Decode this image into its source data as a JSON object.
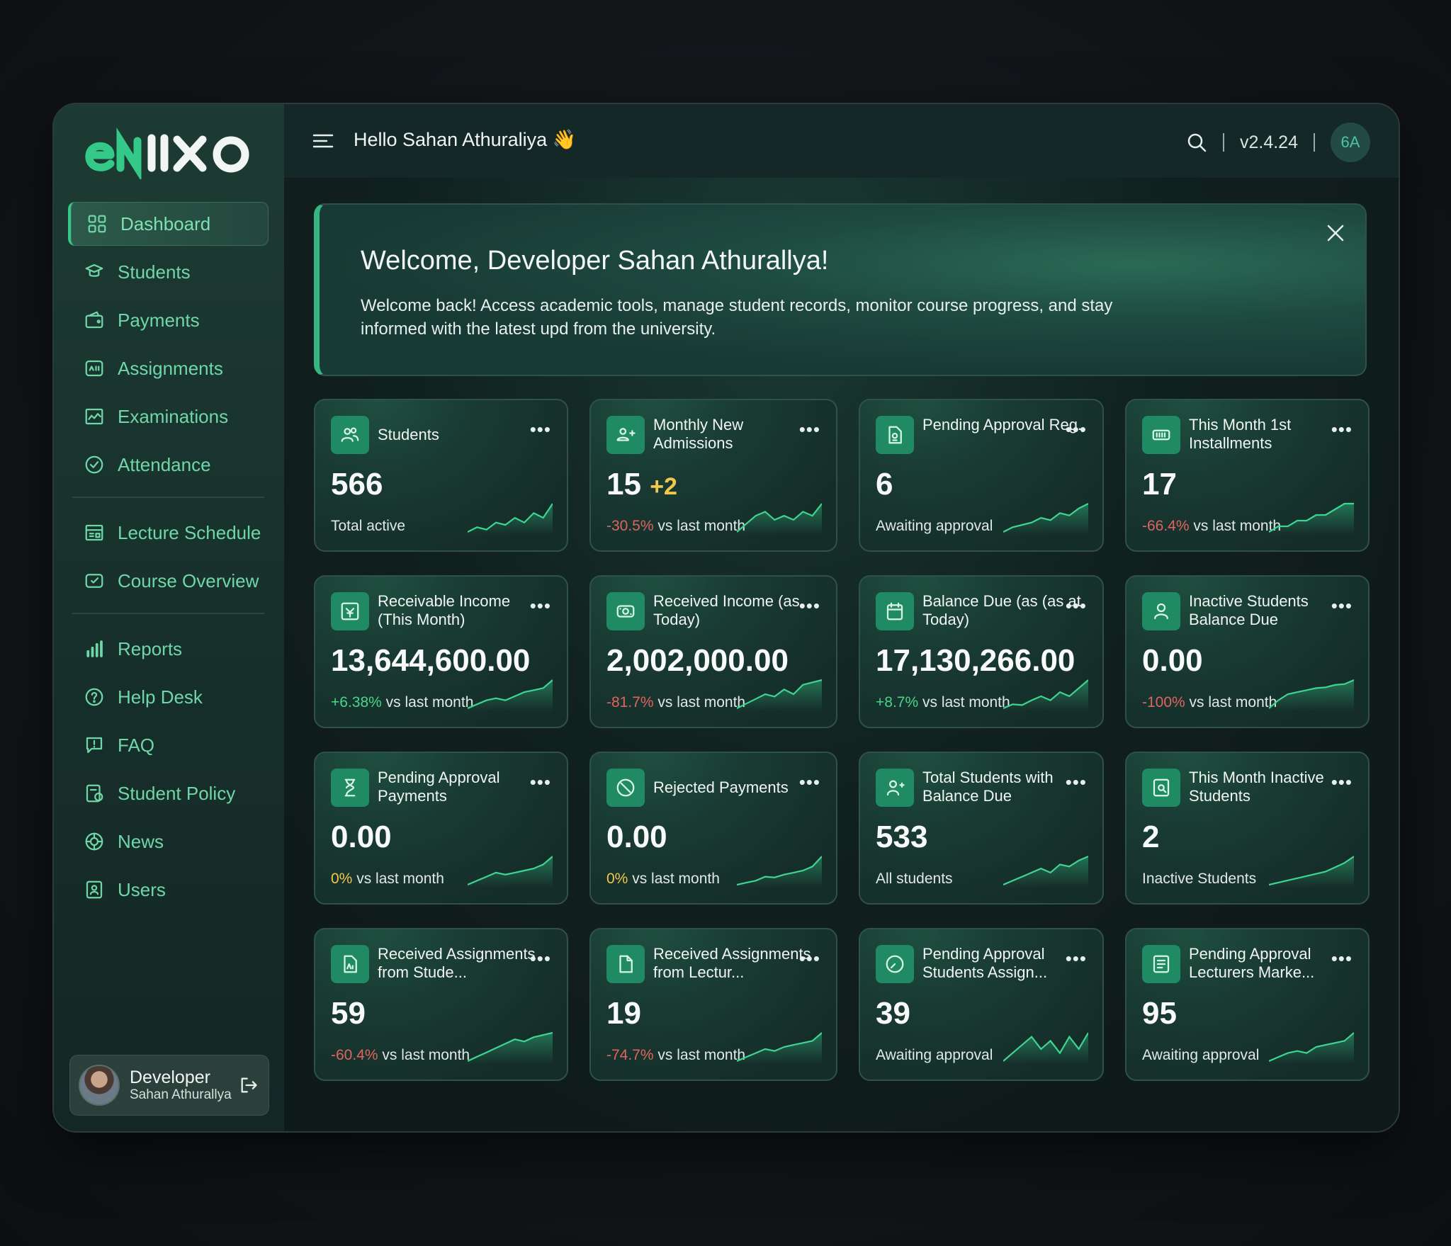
{
  "app": {
    "logo_text": "eNiiXO"
  },
  "sidebar": {
    "items": [
      {
        "label": "Dashboard",
        "icon": "grid-icon",
        "active": true
      },
      {
        "label": "Students",
        "icon": "student-icon"
      },
      {
        "label": "Payments",
        "icon": "wallet-icon"
      },
      {
        "label": "Assignments",
        "icon": "assignment-icon"
      },
      {
        "label": "Examinations",
        "icon": "exam-icon"
      },
      {
        "label": "Attendance",
        "icon": "check-circle-icon"
      }
    ],
    "items2": [
      {
        "label": "Lecture Schedule",
        "icon": "schedule-icon"
      },
      {
        "label": "Course Overview",
        "icon": "course-icon"
      }
    ],
    "items3": [
      {
        "label": "Reports",
        "icon": "bar-chart-icon"
      },
      {
        "label": "Help Desk",
        "icon": "help-icon"
      },
      {
        "label": "FAQ",
        "icon": "faq-icon"
      },
      {
        "label": "Student Policy",
        "icon": "policy-icon"
      },
      {
        "label": "News",
        "icon": "news-icon"
      },
      {
        "label": "Users",
        "icon": "users-icon"
      }
    ],
    "profile": {
      "name": "Developer",
      "subname": "Sahan Athurallya"
    }
  },
  "header": {
    "greeting": "Hello Sahan Athuraliya 👋",
    "version": "v2.4.24",
    "avatar_initials": "6A"
  },
  "welcome": {
    "title": "Welcome, Developer Sahan Athurallya!",
    "text": "Welcome back! Access academic tools, manage student records, monitor course progress, and stay informed with the latest upd from the university."
  },
  "colors": {
    "accent": "#34c889",
    "icon_bg": "#1f8a63",
    "negative": "#e0645e",
    "positive": "#49d488",
    "highlight": "#f0c84a"
  },
  "cards": [
    {
      "title": "Students",
      "value": "566",
      "sub": "Total active",
      "icon": "students-icon",
      "spark": [
        2,
        3,
        2.5,
        4,
        3.5,
        5,
        4,
        6,
        5,
        8
      ]
    },
    {
      "title": "Monthly New Admissions",
      "value": "15",
      "value_extra": "+2",
      "change": "-30.5%",
      "sub": "vs last month",
      "icon": "admission-icon",
      "spark": [
        1,
        3,
        5,
        6,
        4,
        5,
        4,
        6,
        5,
        8
      ]
    },
    {
      "title": "Pending Approval Reg.",
      "value": "6",
      "sub": "Awaiting approval",
      "icon": "document-icon",
      "spark": [
        1,
        2,
        2.5,
        3,
        4,
        3.5,
        5,
        4.5,
        6,
        7
      ]
    },
    {
      "title": "This Month 1st Installments",
      "value": "17",
      "change": "-66.4%",
      "sub": "vs last month",
      "icon": "installment-icon",
      "spark": [
        2,
        3,
        3,
        4,
        4,
        5,
        5,
        6,
        7,
        7
      ]
    },
    {
      "title": "Receivable Income (This Month)",
      "value": "13,644,600.00",
      "change": "+6.38%",
      "sub": "vs last month",
      "icon": "receivable-icon",
      "spark": [
        1,
        2,
        3,
        3.5,
        3,
        4,
        5,
        5.5,
        6,
        8
      ]
    },
    {
      "title": "Received Income (as Today)",
      "value": "2,002,000.00",
      "change": "-81.7%",
      "sub": "vs last month",
      "icon": "cash-icon",
      "spark": [
        1,
        2,
        3,
        4,
        3.5,
        5,
        4,
        6,
        6.5,
        7
      ]
    },
    {
      "title": "Balance Due (as (as at Today)",
      "value": "17,130,266.00",
      "change": "+8.7%",
      "sub": "vs last month",
      "icon": "calendar-icon",
      "spark": [
        1,
        2,
        1.8,
        3,
        4,
        3,
        5,
        4,
        6,
        8
      ]
    },
    {
      "title": "Inactive Students Balance Due",
      "value": "0.00",
      "change": "-100%",
      "sub": "vs last month",
      "icon": "user-icon",
      "spark": [
        1,
        3,
        4.5,
        5,
        5.5,
        6,
        6.2,
        6.8,
        7,
        8
      ]
    },
    {
      "title": "Pending Approval Payments",
      "value": "0.00",
      "change": "0%",
      "sub": "vs last month",
      "icon": "hourglass-icon",
      "spark": [
        1,
        2,
        3,
        4,
        3.5,
        4,
        4.5,
        5,
        6,
        8
      ]
    },
    {
      "title": "Rejected Payments",
      "value": "0.00",
      "change": "0%",
      "sub": "vs last month",
      "icon": "reject-icon",
      "spark": [
        1,
        1.5,
        2,
        3,
        2.8,
        3.5,
        4,
        4.5,
        5.5,
        8
      ]
    },
    {
      "title": "Total Students with Balance Due",
      "value": "533",
      "sub": "All students",
      "icon": "user-balance-icon",
      "spark": [
        1,
        2,
        3,
        4,
        5,
        4,
        6,
        5.5,
        7,
        8
      ]
    },
    {
      "title": "This Month Inactive Students",
      "value": "2",
      "sub": "Inactive Students",
      "icon": "inactive-icon",
      "spark": [
        1,
        1.5,
        2,
        2.5,
        3,
        3.5,
        4,
        5,
        6,
        7.5
      ]
    },
    {
      "title": "Received Assignments from Stude...",
      "value": "59",
      "change": "-60.4%",
      "sub": "vs last month",
      "icon": "assignment-received-icon",
      "spark": [
        1,
        2,
        3,
        4,
        5,
        6,
        5.5,
        6.5,
        7,
        7.5
      ]
    },
    {
      "title": "Received Assignments from Lectur...",
      "value": "19",
      "change": "-74.7%",
      "sub": "vs last month",
      "icon": "file-icon",
      "spark": [
        1,
        2,
        3,
        4,
        3.5,
        4.5,
        5,
        5.5,
        6,
        8
      ]
    },
    {
      "title": "Pending Approval Students Assign...",
      "value": "39",
      "sub": "Awaiting approval",
      "icon": "clock-icon",
      "spark": [
        1,
        3,
        5,
        7,
        4,
        6,
        3,
        7,
        4,
        8
      ]
    },
    {
      "title": "Pending Approval Lecturers Marke...",
      "value": "95",
      "sub": "Awaiting approval",
      "icon": "marks-icon",
      "spark": [
        1,
        2,
        3,
        3.5,
        3,
        4.5,
        5,
        5.5,
        6,
        8
      ]
    }
  ]
}
